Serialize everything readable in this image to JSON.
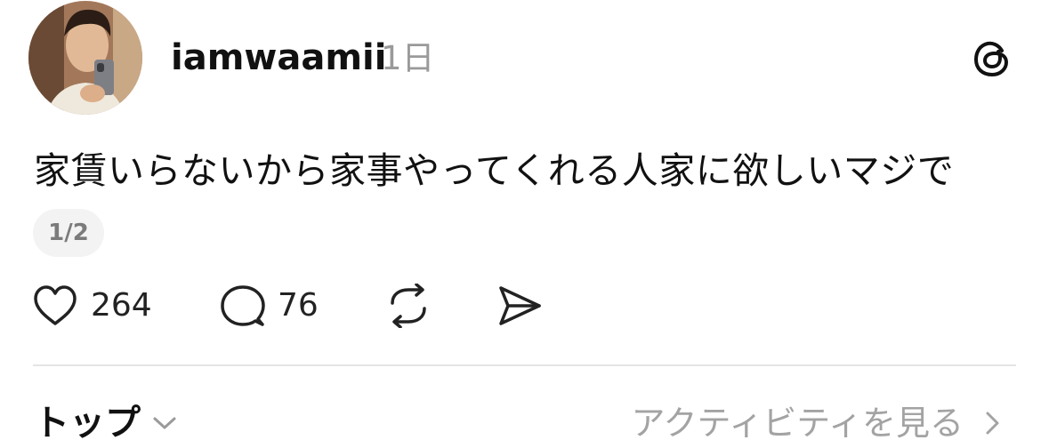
{
  "post": {
    "username": "iamwaamii",
    "timestamp": "1日",
    "text": "家賃いらないから家事やってくれる人家に欲しいマジで",
    "page_indicator": "1/2"
  },
  "actions": {
    "likes": "264",
    "replies": "76"
  },
  "footer": {
    "sort_label": "トップ",
    "activity_label": "アクティビティを見る"
  },
  "icons": {
    "app_logo": "threads-logo-icon",
    "like": "heart-icon",
    "reply": "speech-bubble-icon",
    "repost": "repost-icon",
    "share": "paper-plane-icon",
    "sort": "chevron-down-icon",
    "activity": "chevron-right-icon"
  },
  "colors": {
    "text": "#111111",
    "muted": "#9a9a9a",
    "divider": "#e5e5e5",
    "pill": "#f3f3f3"
  }
}
